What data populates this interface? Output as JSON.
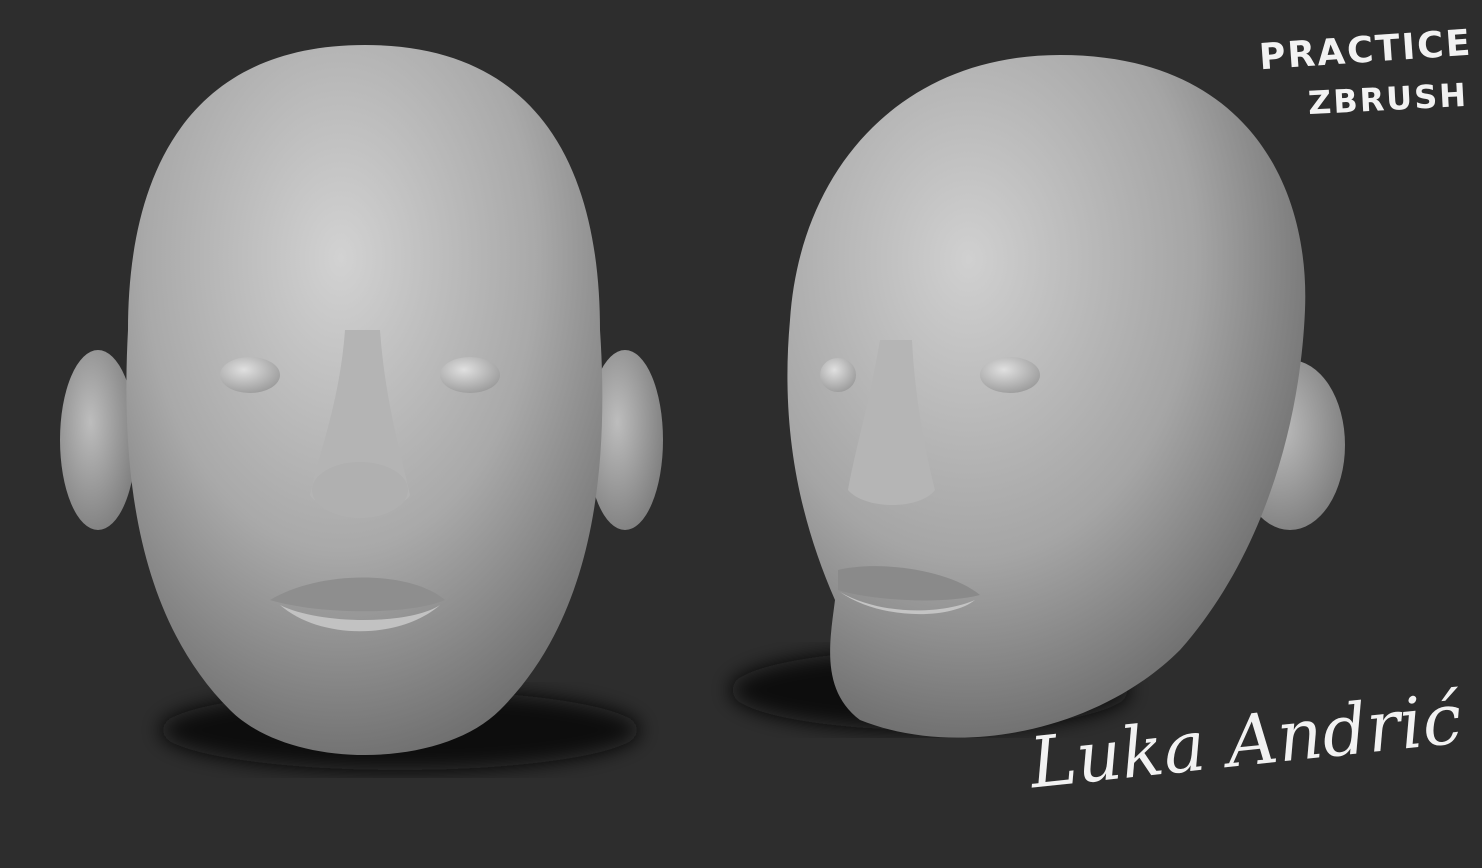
{
  "artwork": {
    "subject": "two sculpted bald male heads, front and three-quarter view",
    "background_color": "#2d2d2d",
    "material_color": "#b8b8b8"
  },
  "annotations": {
    "line1": "PRACTICE",
    "line2": "ZBRUSH"
  },
  "signature": "Luka Andrić"
}
